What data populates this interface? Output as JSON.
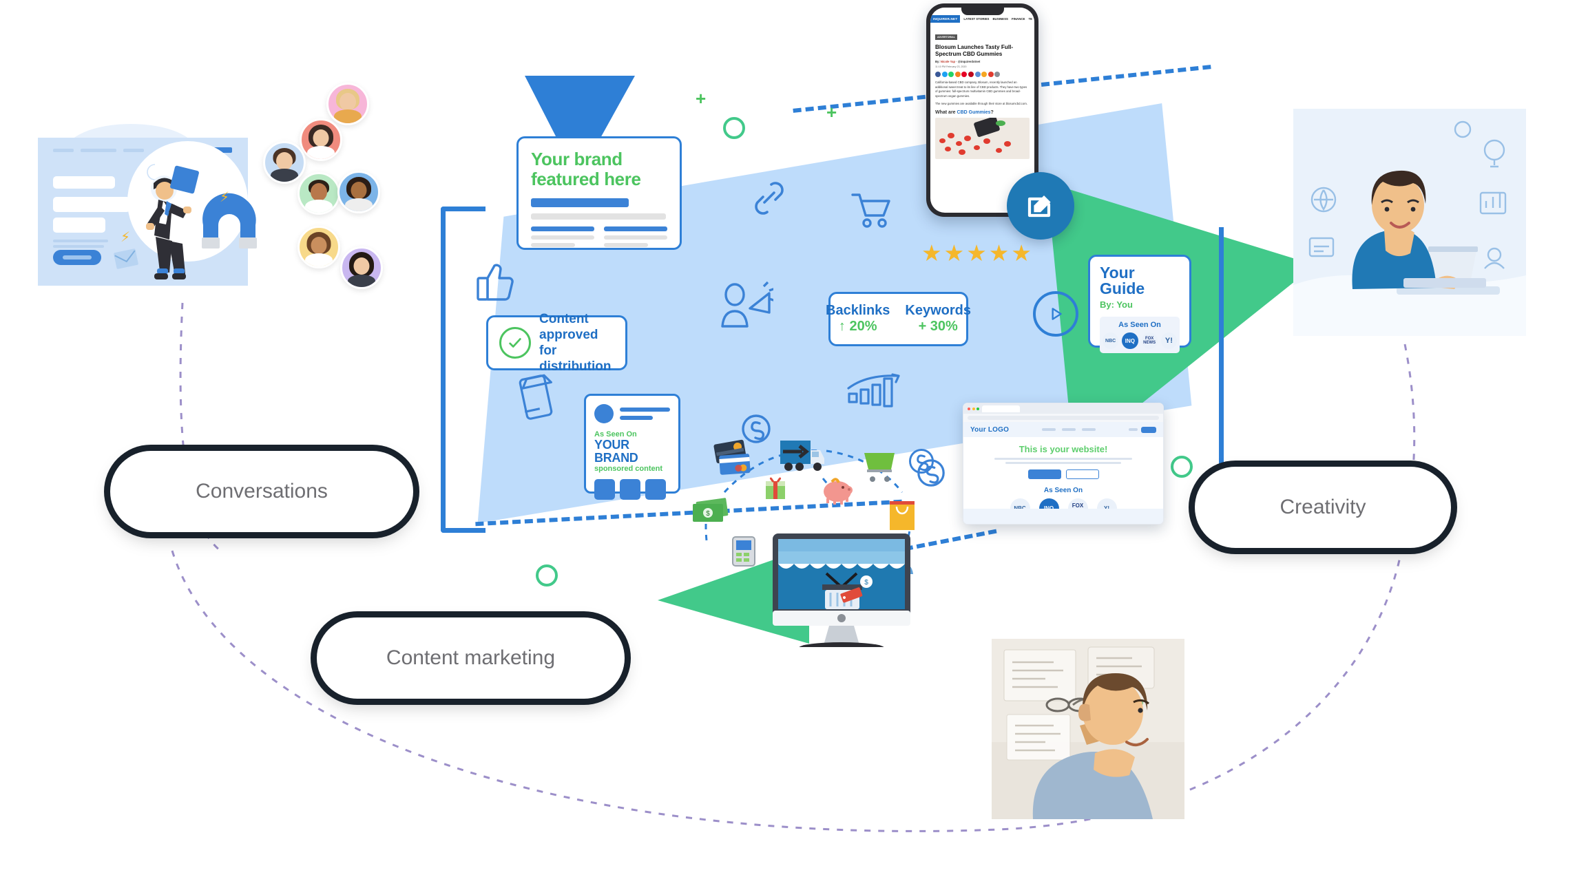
{
  "theme": {
    "blue": "#2e7fd6",
    "light_blue": "#bedcfb",
    "green": "#4cc45f",
    "teal_green": "#42c98a",
    "gold": "#f5b72b",
    "text_grey": "#6e6e72"
  },
  "pills": [
    {
      "label": "Conversations",
      "name": "pill-conversations"
    },
    {
      "label": "Content marketing",
      "name": "pill-content-marketing"
    },
    {
      "label": "Creativity",
      "name": "pill-creativity"
    }
  ],
  "brand_card": {
    "title_line1": "Your brand",
    "title_line2": "featured here"
  },
  "approved_card": {
    "line1": "Content approved",
    "line2": "for distribution",
    "icon": "check-circle-icon"
  },
  "metrics_card": {
    "metrics": [
      {
        "label": "Backlinks",
        "value": "↑ 20%"
      },
      {
        "label": "Keywords",
        "value": "+ 30%"
      }
    ]
  },
  "guide_card": {
    "title": "Your Guide",
    "byline": "By: You",
    "seen_on_label": "As Seen On",
    "badges": [
      "NBC",
      "INQ",
      "FOX NEWS",
      "Y!"
    ]
  },
  "sponsor_card": {
    "seen_on": "As Seen On",
    "brand": "YOUR BRAND",
    "subtitle": "sponsored content"
  },
  "phone_article": {
    "site_logo": "INQUIRER.NET",
    "nav_items": [
      "LATEST STORIES",
      "BUSINESS",
      "FINANCE",
      "TE"
    ],
    "tag": "ADVERTORIAL",
    "headline": "Blosum Launches Tasty Full-Spectrum CBD Gummies",
    "byline_prefix": "By:",
    "author": "Nicole Yap",
    "handle": "· @inquirerdotnet",
    "timestamp": "11:10 PM February 23, 2020",
    "paragraph1": "California-based CBD company, Blosum, recently launched an additional sweet treat to its line of CBD products. They have two types of gummies: full-spectrum multivitamin CBD gummies and broad-spectrum vegan gummies.",
    "paragraph1_link": "Blosum",
    "paragraph2": "The new gummies are available through their store at blosumcbd.com.",
    "subhead_plain": "What are ",
    "subhead_link": "CBD Gummies",
    "subhead_end": "?"
  },
  "browser_window": {
    "logo": "Your LOGO",
    "headline": "This is your website!",
    "seen_on_label": "As Seen On",
    "badges": [
      "NBC",
      "INQ",
      "FOX NEWS",
      "Y!"
    ]
  },
  "stars": {
    "count": 5,
    "glyph": "★"
  },
  "icons": {
    "edit_button": "edit-icon",
    "play_button": "play-icon",
    "thumbs_up": "thumbs-up-icon",
    "link_chain": "link-icon",
    "shopping_cart": "shopping-cart-icon",
    "megaphone": "megaphone-person-icon",
    "mobile_shop": "mobile-shop-icon",
    "dollar_coin": "dollar-coin-icon",
    "growth_chart": "growth-chart-icon"
  },
  "avatars": [
    {
      "bg": "#f7b6d8",
      "hair": "#e8c887",
      "name": "avatar-1"
    },
    {
      "bg": "#f08b7e",
      "hair": "#3a2a24",
      "name": "avatar-2"
    },
    {
      "bg": "#c6dcf4",
      "hair": "#4a3326",
      "name": "avatar-3"
    },
    {
      "bg": "#b9e8c4",
      "hair": "#2d2018",
      "name": "avatar-4"
    },
    {
      "bg": "#7cb4e8",
      "hair": "#2b1d16",
      "name": "avatar-5"
    },
    {
      "bg": "#f7d98a",
      "hair": "#6b4326",
      "name": "avatar-6"
    },
    {
      "bg": "#c9b7f0",
      "hair": "#241a14",
      "name": "avatar-7"
    }
  ]
}
